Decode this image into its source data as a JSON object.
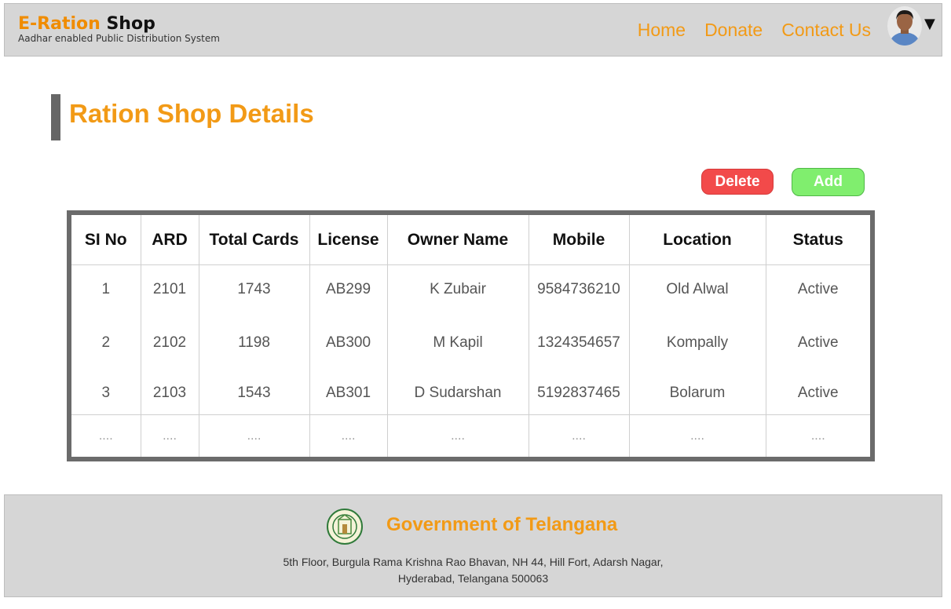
{
  "header": {
    "brand_part1": "E-Ration",
    "brand_part2": "Shop",
    "subtitle": "Aadhar enabled Public Distribution System",
    "nav": [
      "Home",
      "Donate",
      "Contact Us"
    ],
    "avatar_icon": "user-avatar",
    "caret_icon": "caret-down-icon"
  },
  "page": {
    "title": "Ration Shop Details"
  },
  "actions": {
    "delete_label": "Delete",
    "add_label": "Add"
  },
  "table": {
    "columns": [
      "SI No",
      "ARD",
      "Total Cards",
      "License",
      "Owner Name",
      "Mobile",
      "Location",
      "Status"
    ],
    "rows": [
      [
        "1",
        "2101",
        "1743",
        "AB299",
        "K Zubair",
        "9584736210",
        "Old Alwal",
        "Active"
      ],
      [
        "2",
        "2102",
        "1198",
        "AB300",
        "M Kapil",
        "1324354657",
        "Kompally",
        "Active"
      ],
      [
        "3",
        "2103",
        "1543",
        "AB301",
        "D Sudarshan",
        "5192837465",
        "Bolarum",
        "Active"
      ],
      [
        "....",
        "....",
        "....",
        "....",
        "....",
        "....",
        "....",
        "...."
      ]
    ]
  },
  "footer": {
    "title": "Government of Telangana",
    "address_line1": "5th Floor, Burgula Rama Krishna Rao Bhavan, NH 44, Hill Fort, Adarsh Nagar,",
    "address_line2": "Hyderabad, Telangana 500063",
    "seal_icon": "telangana-seal"
  },
  "colors": {
    "accent": "#f29a16",
    "delete": "#f24a4a",
    "add": "#80ee6e",
    "header_bg": "#d6d6d6"
  }
}
